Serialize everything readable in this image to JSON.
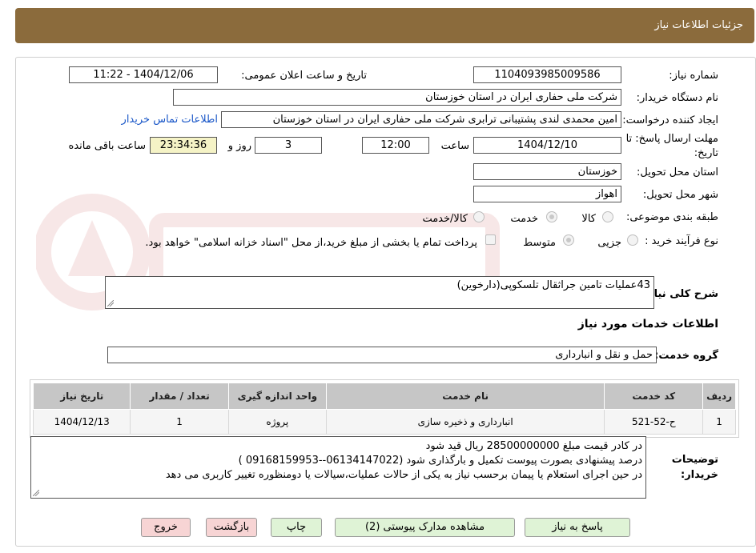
{
  "header": {
    "title": "جزئیات اطلاعات نیاز"
  },
  "form": {
    "need_number_label": "شماره نیاز:",
    "need_number": "1104093985009586",
    "announce_label": "تاریخ و ساعت اعلان عمومی:",
    "announce_value": "1404/12/06 - 11:22",
    "buyer_org_label": "نام دستگاه خریدار:",
    "buyer_org": "شرکت ملی حفاری ایران در استان خوزستان",
    "requester_label": "ایجاد کننده درخواست:",
    "requester": "امین محمدی لندی پشتیبانی ترابری شرکت ملی حفاری ایران در استان خوزستان",
    "contact_link": "اطلاعات تماس خریدار",
    "deadline_label_1": "مهلت ارسال پاسخ: تا",
    "deadline_label_2": "تاریخ:",
    "deadline_date": "1404/12/10",
    "time_label": "ساعت",
    "deadline_time": "12:00",
    "days": "3",
    "days_label": "روز و",
    "remaining_time": "23:34:36",
    "remaining_label": "ساعت باقی مانده",
    "province_label": "استان محل تحویل:",
    "province": "خوزستان",
    "city_label": "شهر محل تحویل:",
    "city": "اهواز",
    "category_label": "طبقه بندی موضوعی:",
    "category_options": [
      "کالا",
      "خدمت",
      "کالا/خدمت"
    ],
    "process_label": "نوع فرآیند خرید :",
    "process_options": [
      "جزیی",
      "متوسط"
    ],
    "payment_note": "پرداخت تمام یا بخشی از مبلغ خرید،از محل \"اسناد خزانه اسلامی\" خواهد بود.",
    "summary_label": "شرح کلی نیاز:",
    "summary": "43عملیات تامین جراثقال تلسکوپی(دارخوین)",
    "services_heading": "اطلاعات خدمات مورد نیاز",
    "service_group_label": "گروه خدمت:",
    "service_group": "حمل و نقل و انبارداری"
  },
  "table": {
    "headers": [
      "ردیف",
      "کد خدمت",
      "نام خدمت",
      "واحد اندازه گیری",
      "تعداد / مقدار",
      "تاریخ نیاز"
    ],
    "rows": [
      [
        "1",
        "ح-52-521",
        "انبارداری و ذخیره سازی",
        "پروژه",
        "1",
        "1404/12/13"
      ]
    ]
  },
  "notes": {
    "label_1": "توضیحات",
    "label_2": "خریدار:",
    "lines": [
      "در کادر قیمت مبلغ 28500000000 ریال قید شود",
      "درصد پیشنهادی بصورت پیوست تکمیل و بارگذاری شود (06134147022--09168159953 )",
      "در حین اجرای استعلام یا پیمان برحسب نیاز به یکی از حالات عملیات،سیالات یا دومنظوره تغییر کاربری می دهد"
    ]
  },
  "buttons": {
    "reply": "پاسخ به نیاز",
    "attachments": "مشاهده مدارک پیوستی (2)",
    "print": "چاپ",
    "back": "بازگشت",
    "exit": "خروج"
  },
  "colors": {
    "header": "#8b6b3c",
    "link": "#1a57c8",
    "green_button": "#dff3d6",
    "pink_button": "#f7d4d4",
    "remaining_bg": "#f5f3c6"
  }
}
